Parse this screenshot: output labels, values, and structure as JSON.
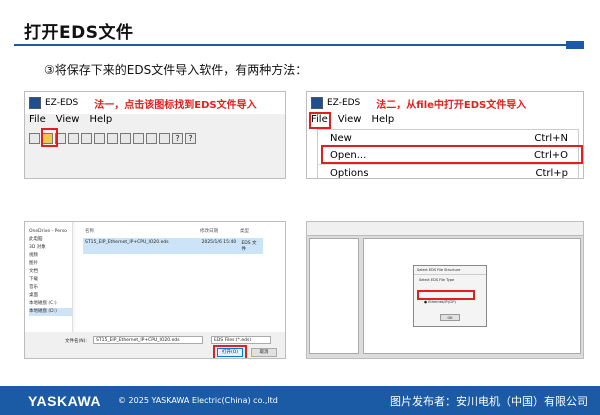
{
  "title": "打开EDS文件",
  "subtitle": "③将保存下来的EDS文件导入软件，有两种方法：",
  "method1": {
    "app_title": "EZ-EDS",
    "note": "法一，点击该图标找到EDS文件导入",
    "menu": [
      "File",
      "View",
      "Help"
    ]
  },
  "method2": {
    "app_title": "EZ-EDS",
    "note": "法二，从file中打开EDS文件导入",
    "menu": [
      "File",
      "View",
      "Help"
    ],
    "items": [
      {
        "label": "New",
        "shortcut": "Ctrl+N"
      },
      {
        "label": "Open...",
        "shortcut": "Ctrl+O"
      },
      {
        "label": "Options",
        "shortcut": "Ctrl+p"
      }
    ]
  },
  "dialog": {
    "nav_items": [
      "OneDrive - Perso",
      "此电脑",
      "3D 对象",
      "视频",
      "图片",
      "文档",
      "下载",
      "音乐",
      "桌面",
      "本地磁盘 (C:)",
      "本地磁盘 (D:)"
    ],
    "col_name": "名称",
    "col_date": "修改日期",
    "col_type": "类型",
    "file_name": "ST15_EIP_Ethernet_IP+CPU_IO20.eds",
    "file_date": "2025/1/6 15:40",
    "file_type": "EDS 文件",
    "filename_label": "文件名(N):",
    "filter": "EDS Files (*.eds)",
    "open_button": "打开(O)",
    "cancel_button": "取消"
  },
  "wizard": {
    "title": "Select EDS File Structure",
    "prompt": "Select EDS File Type",
    "option_selected": "Ethernet/IP(CIP)",
    "ok_button": "OK"
  },
  "footer": {
    "logo": "YASKAWA",
    "copyright": "© 2025 YASKAWA Electric(China) co.,ltd",
    "publisher": "图片发布者：安川电机（中国）有限公司"
  },
  "colors": {
    "brand": "#1b5aa5",
    "highlight": "#e02020"
  }
}
